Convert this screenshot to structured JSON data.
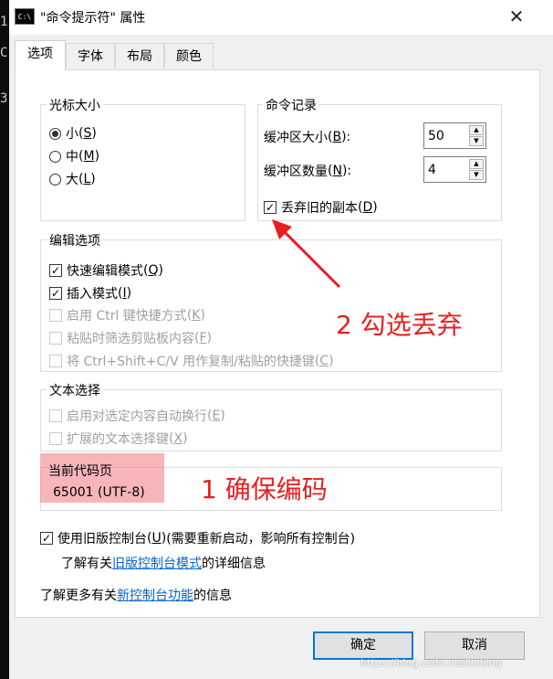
{
  "window": {
    "title": "\"命令提示符\" 属性",
    "close_icon": "close-icon"
  },
  "tabs": [
    "选项",
    "字体",
    "布局",
    "颜色"
  ],
  "cursor_size": {
    "legend": "光标大小",
    "options": [
      {
        "label": "小",
        "key": "S",
        "selected": true
      },
      {
        "label": "中",
        "key": "M",
        "selected": false
      },
      {
        "label": "大",
        "key": "L",
        "selected": false
      }
    ]
  },
  "history": {
    "legend": "命令记录",
    "buffer_size_label": "缓冲区大小",
    "buffer_size_key": "B",
    "buffer_size_value": "50",
    "buffer_count_label": "缓冲区数量",
    "buffer_count_key": "N",
    "buffer_count_value": "4",
    "discard_label": "丢弃旧的副本",
    "discard_key": "D",
    "discard_checked": true
  },
  "edit_options": {
    "legend": "编辑选项",
    "items": [
      {
        "label": "快速编辑模式",
        "key": "Q",
        "checked": true,
        "enabled": true
      },
      {
        "label": "插入模式",
        "key": "I",
        "checked": true,
        "enabled": true
      },
      {
        "label": "启用 Ctrl 键快捷方式",
        "key": "K",
        "checked": false,
        "enabled": false
      },
      {
        "label": "粘贴时筛选剪贴板内容",
        "key": "F",
        "checked": false,
        "enabled": false
      },
      {
        "label": "将 Ctrl+Shift+C/V 用作复制/粘贴的快捷键",
        "key": "C",
        "checked": false,
        "enabled": false
      }
    ]
  },
  "text_selection": {
    "legend": "文本选择",
    "items": [
      {
        "label": "启用对选定内容自动换行",
        "key": "E",
        "checked": false,
        "enabled": false
      },
      {
        "label": "扩展的文本选择键",
        "key": "X",
        "checked": false,
        "enabled": false
      }
    ]
  },
  "codepage": {
    "legend": "当前代码页",
    "value": "65001 (UTF-8)"
  },
  "legacy": {
    "label_pre": "使用旧版控制台",
    "key": "U",
    "label_post": "(需要重新启动，影响所有控制台)",
    "checked": true,
    "info_pre": "了解有关",
    "info_link": "旧版控制台模式",
    "info_post": "的详细信息"
  },
  "more_info": {
    "pre": "了解更多有关",
    "link": "新控制台功能",
    "post": "的信息"
  },
  "annotations": {
    "step1": "1 确保编码",
    "step2": "2 勾选丢弃"
  },
  "buttons": {
    "ok": "确定",
    "cancel": "取消"
  },
  "watermark": "https://blog.csdn.net/liubing",
  "colors": {
    "annotation_red": "#e62020",
    "link_blue": "#0066cc",
    "focus_blue": "#0078d7",
    "highlight_pink": "#f07882"
  }
}
